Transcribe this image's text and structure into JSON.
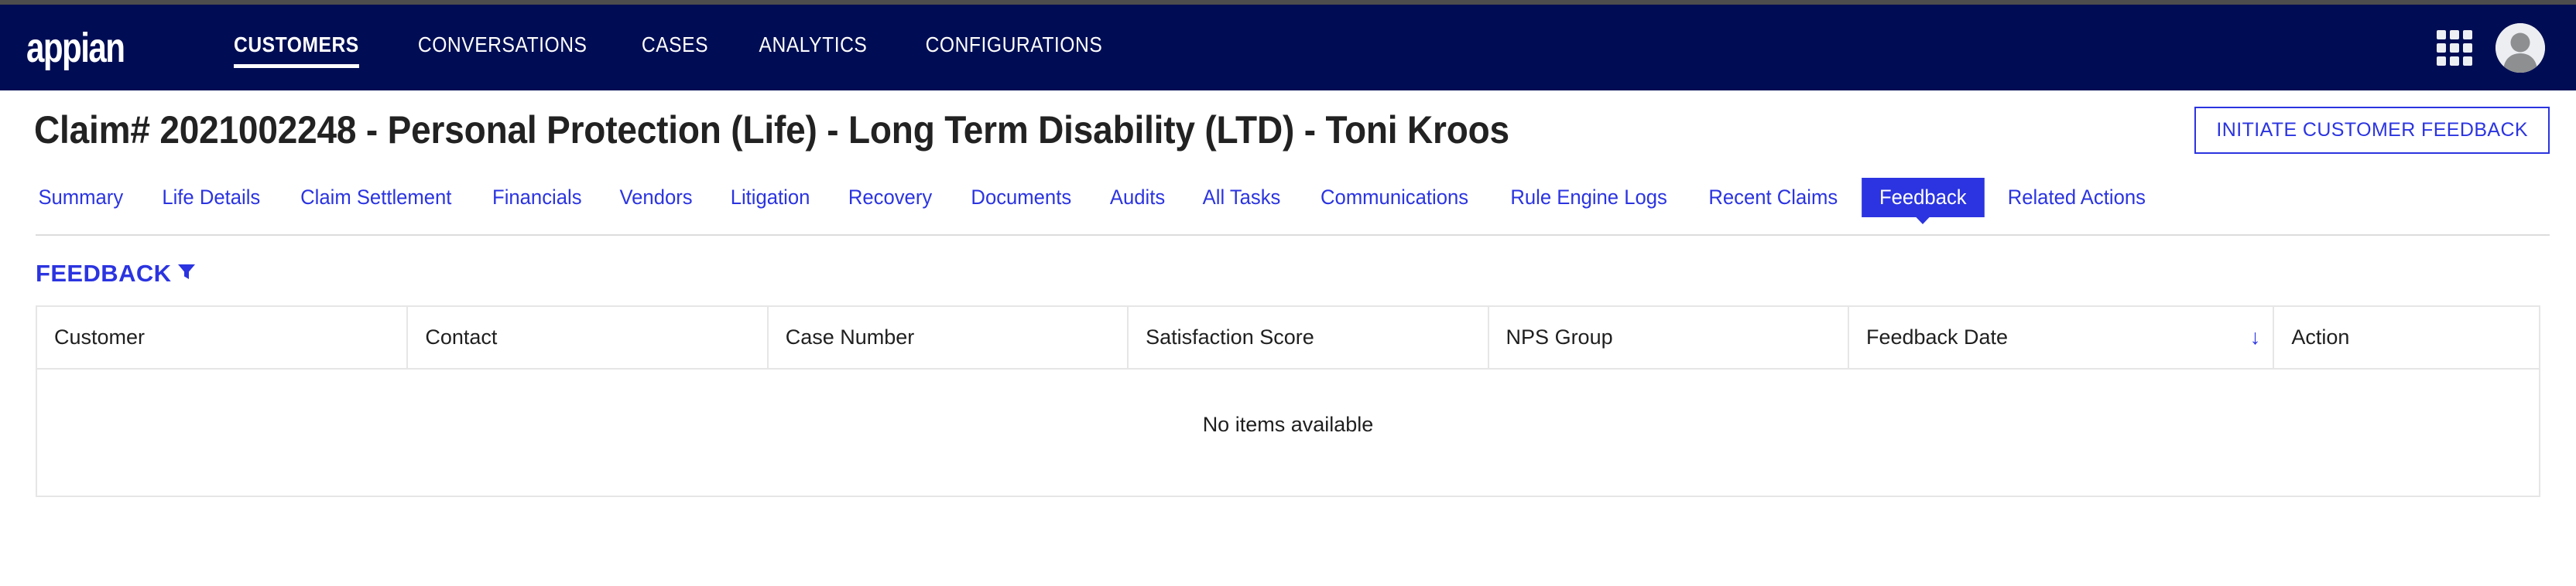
{
  "header": {
    "logo_text": "appian",
    "nav_items": [
      {
        "label": "CUSTOMERS",
        "active": true
      },
      {
        "label": "CONVERSATIONS",
        "active": false
      },
      {
        "label": "CASES",
        "active": false
      },
      {
        "label": "ANALYTICS",
        "active": false
      },
      {
        "label": "CONFIGURATIONS",
        "active": false
      }
    ],
    "apps_icon": "grid-apps-icon",
    "avatar_icon": "user-avatar-icon",
    "background_color": "#000d54"
  },
  "page": {
    "title": "Claim# 2021002248 - Personal Protection (Life) - Long Term Disability (LTD) - Toni Kroos",
    "primary_action_label": "INITIATE CUSTOMER FEEDBACK",
    "accent_color": "#2b34e0"
  },
  "tabs": [
    {
      "label": "Summary",
      "active": false
    },
    {
      "label": "Life Details",
      "active": false
    },
    {
      "label": "Claim Settlement",
      "active": false
    },
    {
      "label": "Financials",
      "active": false
    },
    {
      "label": "Vendors",
      "active": false
    },
    {
      "label": "Litigation",
      "active": false
    },
    {
      "label": "Recovery",
      "active": false
    },
    {
      "label": "Documents",
      "active": false
    },
    {
      "label": "Audits",
      "active": false
    },
    {
      "label": "All Tasks",
      "active": false
    },
    {
      "label": "Communications",
      "active": false
    },
    {
      "label": "Rule Engine Logs",
      "active": false
    },
    {
      "label": "Recent Claims",
      "active": false
    },
    {
      "label": "Feedback",
      "active": true
    },
    {
      "label": "Related Actions",
      "active": false
    }
  ],
  "section": {
    "title": "FEEDBACK",
    "filter_icon": "filter-funnel-icon"
  },
  "table": {
    "columns": [
      {
        "label": "Customer",
        "sorted": false
      },
      {
        "label": "Contact",
        "sorted": false
      },
      {
        "label": "Case Number",
        "sorted": false
      },
      {
        "label": "Satisfaction Score",
        "sorted": false
      },
      {
        "label": "NPS Group",
        "sorted": false
      },
      {
        "label": "Feedback Date",
        "sorted": true,
        "sort_direction": "↓"
      },
      {
        "label": "Action",
        "sorted": false
      }
    ],
    "rows": [],
    "empty_message": "No items available"
  }
}
